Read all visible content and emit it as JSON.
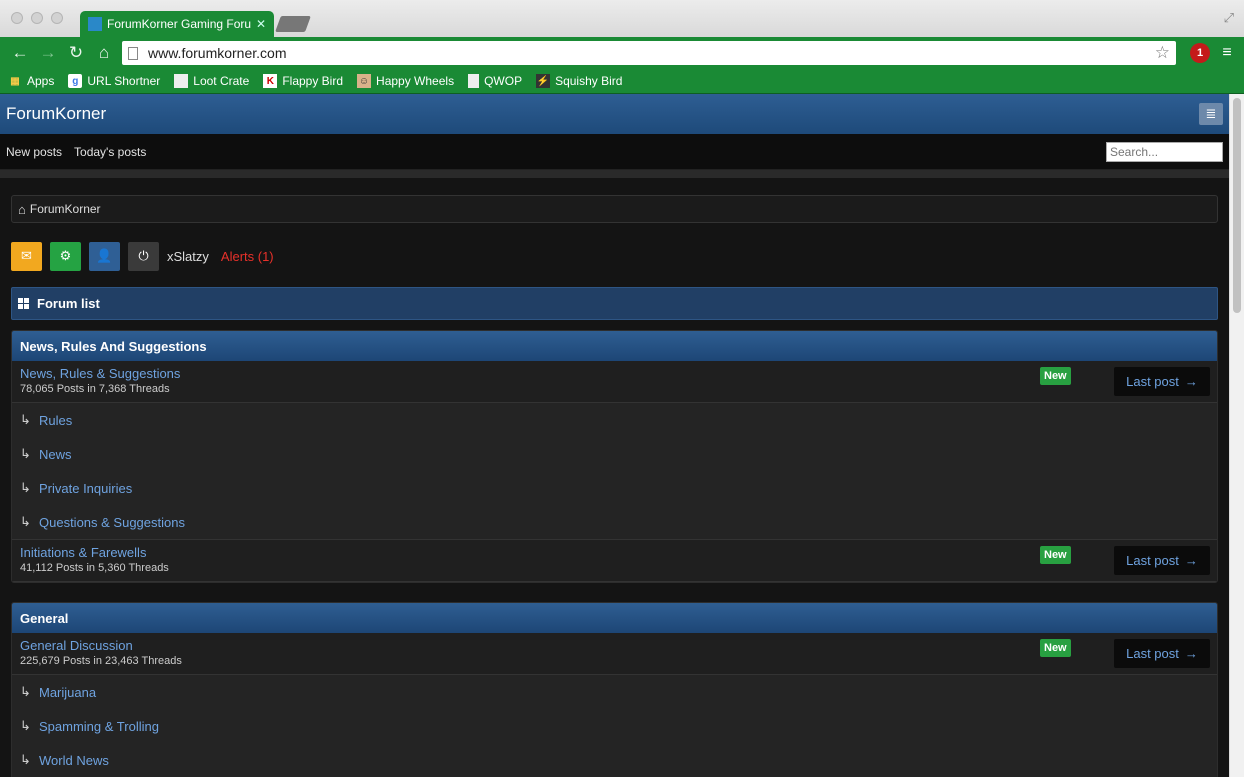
{
  "browser": {
    "tab_title": "ForumKorner Gaming Foru",
    "url": "www.forumkorner.com",
    "extension_badge": "1",
    "bookmarks": [
      {
        "label": "Apps",
        "icon": "apps-grid-icon"
      },
      {
        "label": "URL Shortner",
        "icon": "google-icon"
      },
      {
        "label": "Loot Crate",
        "icon": "page-icon"
      },
      {
        "label": "Flappy Bird",
        "icon": "k-icon"
      },
      {
        "label": "Happy Wheels",
        "icon": "face-icon"
      },
      {
        "label": "QWOP",
        "icon": "page-icon"
      },
      {
        "label": "Squishy Bird",
        "icon": "lightning-icon"
      }
    ]
  },
  "site": {
    "title": "ForumKorner",
    "nav_new_posts": "New posts",
    "nav_todays_posts": "Today's posts",
    "search_placeholder": "Search...",
    "breadcrumb": "ForumKorner",
    "username": "xSlatzy",
    "alerts": "Alerts (1)",
    "forum_list_title": "Forum list"
  },
  "categories": [
    {
      "title": "News, Rules And Suggestions",
      "forums": [
        {
          "name": "News, Rules & Suggestions",
          "stats": "78,065 Posts in 7,368 Threads",
          "badge": "New",
          "last_post": "Last post",
          "subforums": [
            "Rules",
            "News",
            "Private Inquiries",
            "Questions & Suggestions"
          ]
        },
        {
          "name": "Initiations & Farewells",
          "stats": "41,112 Posts in 5,360 Threads",
          "badge": "New",
          "last_post": "Last post",
          "subforums": []
        }
      ]
    },
    {
      "title": "General",
      "forums": [
        {
          "name": "General Discussion",
          "stats": "225,679 Posts in 23,463 Threads",
          "badge": "New",
          "last_post": "Last post",
          "subforums": [
            "Marijuana",
            "Spamming & Trolling",
            "World News"
          ]
        }
      ]
    }
  ],
  "colors": {
    "browser_green": "#1a8a35",
    "header_blue": "#2e5e93",
    "link_blue": "#6fa3e0",
    "badge_green": "#28a041",
    "alert_red": "#e8312a"
  }
}
